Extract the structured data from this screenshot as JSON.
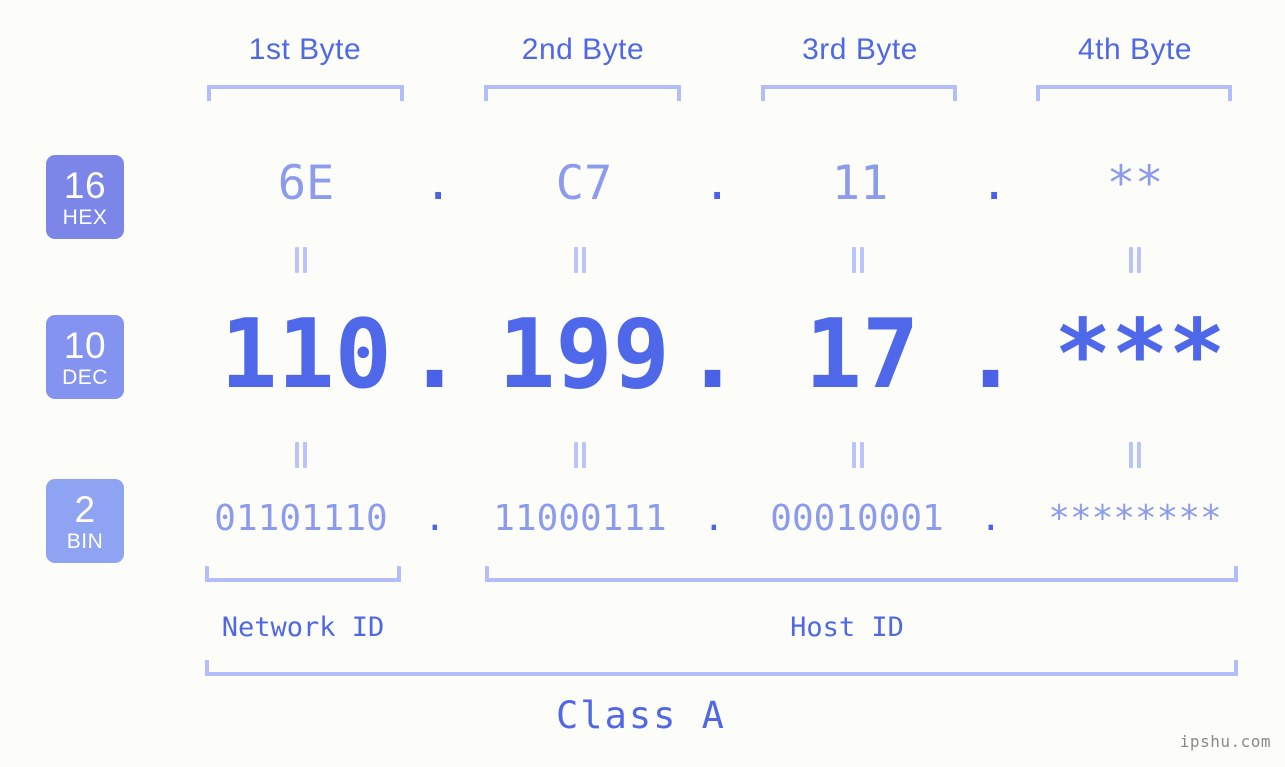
{
  "background": "#fcfdf9",
  "accent": "#5068e6",
  "bracket_color": "#b3bdfa",
  "byte_headers": [
    {
      "label": "1st Byte"
    },
    {
      "label": "2nd Byte"
    },
    {
      "label": "3rd Byte"
    },
    {
      "label": "4th Byte"
    }
  ],
  "radix_badges": [
    {
      "num": "16",
      "unit": "HEX",
      "color": "#7b86e8"
    },
    {
      "num": "10",
      "unit": "DEC",
      "color": "#8593f0"
    },
    {
      "num": "2",
      "unit": "BIN",
      "color": "#8fa3f3"
    }
  ],
  "rows": {
    "hex": {
      "values": [
        "6E",
        "C7",
        "11",
        "**"
      ],
      "separator": "."
    },
    "dec": {
      "values": [
        "110",
        "199",
        "17",
        "***"
      ],
      "separator": "."
    },
    "bin": {
      "values": [
        "01101110",
        "11000111",
        "00010001",
        "********"
      ],
      "separator": "."
    }
  },
  "equals_symbol": "=",
  "sections": [
    {
      "label": "Network ID"
    },
    {
      "label": "Host ID"
    }
  ],
  "class": {
    "label": "Class A"
  },
  "watermark": {
    "text": "ipshu.com"
  }
}
